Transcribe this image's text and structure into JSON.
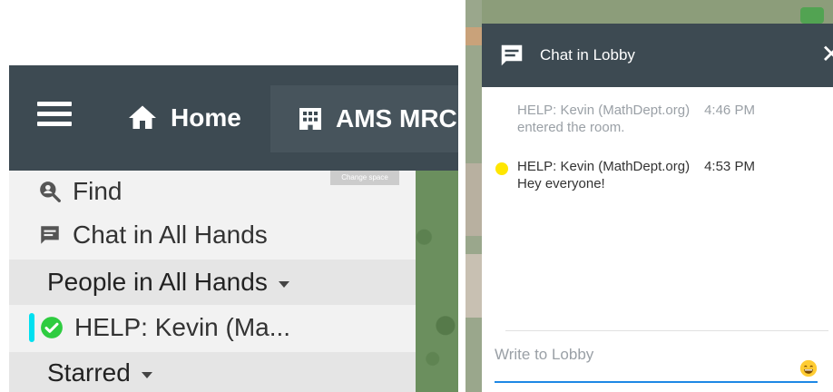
{
  "topbar": {
    "home_label": "Home",
    "space_label": "AMS MRC"
  },
  "sidebar": {
    "change_space_label": "Change space",
    "find_label": "Find",
    "chat_label": "Chat in All Hands",
    "people_label": "People in All Hands",
    "person_name": "HELP: Kevin (Ma...",
    "starred_label": "Starred"
  },
  "chat": {
    "title": "Chat in Lobby",
    "messages": [
      {
        "author": "HELP: Kevin (MathDept.org)",
        "time": "4:46 PM",
        "text": "entered the room.",
        "system": true
      },
      {
        "author": "HELP: Kevin (MathDept.org)",
        "time": "4:53 PM",
        "text": "Hey everyone!",
        "system": false
      }
    ],
    "input_placeholder": "Write to Lobby",
    "input_value": ""
  },
  "colors": {
    "header_bg": "#3d4a52",
    "talking_indicator": "#00e0f0",
    "online_check": "#2ecc40",
    "user_dot": "#ffe600",
    "input_underline": "#1e88e5"
  },
  "icons": {
    "menu": "hamburger-menu-icon",
    "home": "home-icon",
    "space": "building-icon",
    "find": "search-person-icon",
    "chat": "chat-bubble-icon",
    "status": "check-circle-icon",
    "close": "close-icon",
    "emoji": "emoji-smile-icon"
  }
}
